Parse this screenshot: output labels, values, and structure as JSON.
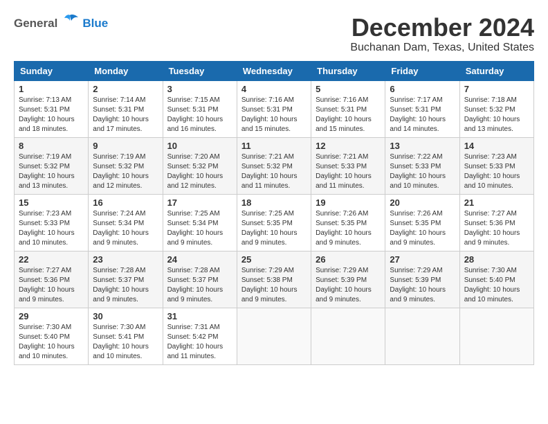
{
  "header": {
    "logo_general": "General",
    "logo_blue": "Blue",
    "month_title": "December 2024",
    "location": "Buchanan Dam, Texas, United States"
  },
  "weekdays": [
    "Sunday",
    "Monday",
    "Tuesday",
    "Wednesday",
    "Thursday",
    "Friday",
    "Saturday"
  ],
  "weeks": [
    [
      {
        "day": "1",
        "sunrise": "7:13 AM",
        "sunset": "5:31 PM",
        "daylight": "10 hours and 18 minutes."
      },
      {
        "day": "2",
        "sunrise": "7:14 AM",
        "sunset": "5:31 PM",
        "daylight": "10 hours and 17 minutes."
      },
      {
        "day": "3",
        "sunrise": "7:15 AM",
        "sunset": "5:31 PM",
        "daylight": "10 hours and 16 minutes."
      },
      {
        "day": "4",
        "sunrise": "7:16 AM",
        "sunset": "5:31 PM",
        "daylight": "10 hours and 15 minutes."
      },
      {
        "day": "5",
        "sunrise": "7:16 AM",
        "sunset": "5:31 PM",
        "daylight": "10 hours and 15 minutes."
      },
      {
        "day": "6",
        "sunrise": "7:17 AM",
        "sunset": "5:31 PM",
        "daylight": "10 hours and 14 minutes."
      },
      {
        "day": "7",
        "sunrise": "7:18 AM",
        "sunset": "5:32 PM",
        "daylight": "10 hours and 13 minutes."
      }
    ],
    [
      {
        "day": "8",
        "sunrise": "7:19 AM",
        "sunset": "5:32 PM",
        "daylight": "10 hours and 13 minutes."
      },
      {
        "day": "9",
        "sunrise": "7:19 AM",
        "sunset": "5:32 PM",
        "daylight": "10 hours and 12 minutes."
      },
      {
        "day": "10",
        "sunrise": "7:20 AM",
        "sunset": "5:32 PM",
        "daylight": "10 hours and 12 minutes."
      },
      {
        "day": "11",
        "sunrise": "7:21 AM",
        "sunset": "5:32 PM",
        "daylight": "10 hours and 11 minutes."
      },
      {
        "day": "12",
        "sunrise": "7:21 AM",
        "sunset": "5:33 PM",
        "daylight": "10 hours and 11 minutes."
      },
      {
        "day": "13",
        "sunrise": "7:22 AM",
        "sunset": "5:33 PM",
        "daylight": "10 hours and 10 minutes."
      },
      {
        "day": "14",
        "sunrise": "7:23 AM",
        "sunset": "5:33 PM",
        "daylight": "10 hours and 10 minutes."
      }
    ],
    [
      {
        "day": "15",
        "sunrise": "7:23 AM",
        "sunset": "5:33 PM",
        "daylight": "10 hours and 10 minutes."
      },
      {
        "day": "16",
        "sunrise": "7:24 AM",
        "sunset": "5:34 PM",
        "daylight": "10 hours and 9 minutes."
      },
      {
        "day": "17",
        "sunrise": "7:25 AM",
        "sunset": "5:34 PM",
        "daylight": "10 hours and 9 minutes."
      },
      {
        "day": "18",
        "sunrise": "7:25 AM",
        "sunset": "5:35 PM",
        "daylight": "10 hours and 9 minutes."
      },
      {
        "day": "19",
        "sunrise": "7:26 AM",
        "sunset": "5:35 PM",
        "daylight": "10 hours and 9 minutes."
      },
      {
        "day": "20",
        "sunrise": "7:26 AM",
        "sunset": "5:35 PM",
        "daylight": "10 hours and 9 minutes."
      },
      {
        "day": "21",
        "sunrise": "7:27 AM",
        "sunset": "5:36 PM",
        "daylight": "10 hours and 9 minutes."
      }
    ],
    [
      {
        "day": "22",
        "sunrise": "7:27 AM",
        "sunset": "5:36 PM",
        "daylight": "10 hours and 9 minutes."
      },
      {
        "day": "23",
        "sunrise": "7:28 AM",
        "sunset": "5:37 PM",
        "daylight": "10 hours and 9 minutes."
      },
      {
        "day": "24",
        "sunrise": "7:28 AM",
        "sunset": "5:37 PM",
        "daylight": "10 hours and 9 minutes."
      },
      {
        "day": "25",
        "sunrise": "7:29 AM",
        "sunset": "5:38 PM",
        "daylight": "10 hours and 9 minutes."
      },
      {
        "day": "26",
        "sunrise": "7:29 AM",
        "sunset": "5:39 PM",
        "daylight": "10 hours and 9 minutes."
      },
      {
        "day": "27",
        "sunrise": "7:29 AM",
        "sunset": "5:39 PM",
        "daylight": "10 hours and 9 minutes."
      },
      {
        "day": "28",
        "sunrise": "7:30 AM",
        "sunset": "5:40 PM",
        "daylight": "10 hours and 10 minutes."
      }
    ],
    [
      {
        "day": "29",
        "sunrise": "7:30 AM",
        "sunset": "5:40 PM",
        "daylight": "10 hours and 10 minutes."
      },
      {
        "day": "30",
        "sunrise": "7:30 AM",
        "sunset": "5:41 PM",
        "daylight": "10 hours and 10 minutes."
      },
      {
        "day": "31",
        "sunrise": "7:31 AM",
        "sunset": "5:42 PM",
        "daylight": "10 hours and 11 minutes."
      },
      null,
      null,
      null,
      null
    ]
  ],
  "labels": {
    "sunrise": "Sunrise:",
    "sunset": "Sunset:",
    "daylight": "Daylight:"
  }
}
